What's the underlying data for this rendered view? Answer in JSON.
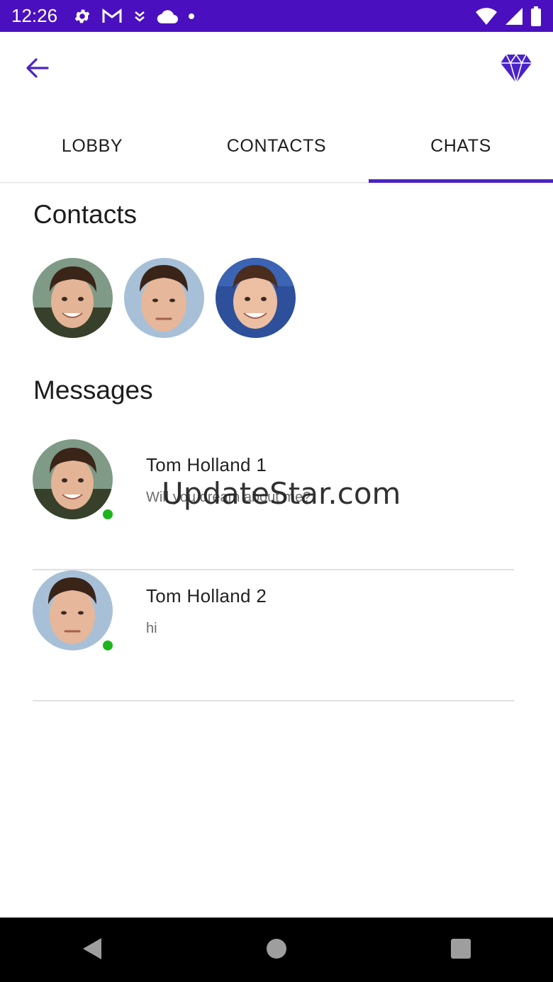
{
  "status_bar": {
    "time": "12:26",
    "icons_left": [
      "settings-gear-icon",
      "gmail-icon",
      "download-icon",
      "cloud-icon",
      "dot-icon"
    ],
    "icons_right": [
      "wifi-icon",
      "cell-signal-icon",
      "battery-icon"
    ]
  },
  "app_bar": {
    "back_icon": "arrow-left-icon",
    "action_icon": "diamond-icon",
    "accent_color": "#4a23c7"
  },
  "tabs": [
    {
      "label": "LOBBY",
      "active": false
    },
    {
      "label": "CONTACTS",
      "active": false
    },
    {
      "label": "CHATS",
      "active": true
    }
  ],
  "contacts": {
    "title": "Contacts",
    "avatars": [
      "avatar-1",
      "avatar-2",
      "avatar-3"
    ]
  },
  "messages": {
    "title": "Messages",
    "items": [
      {
        "name": "Tom Holland 1",
        "preview": "Will you dream about me?",
        "online": true
      },
      {
        "name": "Tom Holland 2",
        "preview": "hi",
        "online": true
      }
    ]
  },
  "watermark": "UpdateStar.com",
  "colors": {
    "status_bar": "#4a0fbf",
    "online": "#1cb51c",
    "divider": "#e0e0e0"
  }
}
